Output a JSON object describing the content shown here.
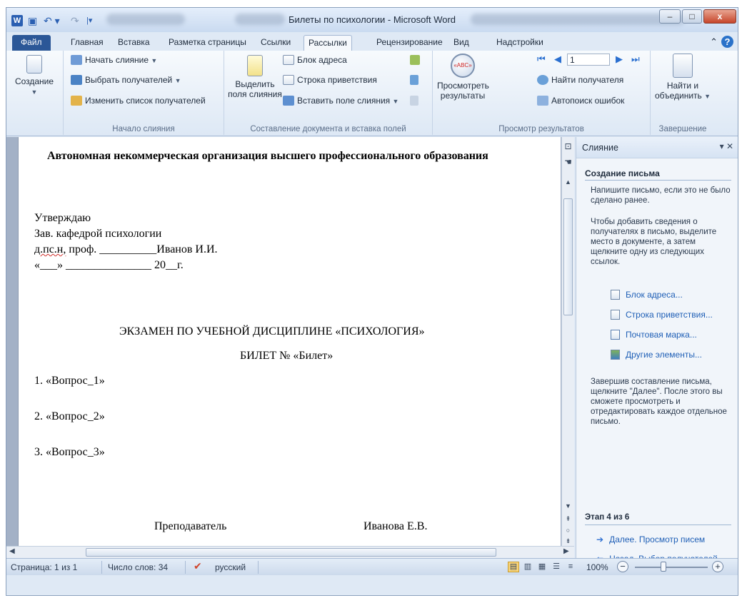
{
  "window": {
    "title": "Билеты по психологии - Microsoft Word",
    "app_letter": "W",
    "minimize": "–",
    "maximize": "□",
    "close": "x"
  },
  "tabs": [
    {
      "label": "Файл"
    },
    {
      "label": "Главная"
    },
    {
      "label": "Вставка"
    },
    {
      "label": "Разметка страницы"
    },
    {
      "label": "Ссылки"
    },
    {
      "label": "Рассылки"
    },
    {
      "label": "Рецензирование"
    },
    {
      "label": "Вид"
    },
    {
      "label": "Надстройки"
    }
  ],
  "active_tab": "Рассылки",
  "ribbon": {
    "create_label": "Создание",
    "start_merge": {
      "label": "Начало слияния",
      "start": "Начать слияние",
      "select_recipients": "Выбрать получателей",
      "edit_list": "Изменить список получателей"
    },
    "compose": {
      "label": "Составление документа и вставка полей",
      "highlight_line1": "Выделить",
      "highlight_line2": "поля слияния",
      "address_block": "Блок адреса",
      "greeting_line": "Строка приветствия",
      "insert_field": "Вставить поле слияния"
    },
    "preview": {
      "label": "Просмотр результатов",
      "preview_line1": "Просмотреть",
      "preview_line2": "результаты",
      "record_number": "1",
      "find_recipient": "Найти получателя",
      "auto_check": "Автопоиск ошибок",
      "abc": "«ABC»"
    },
    "finish": {
      "label": "Завершение",
      "line1": "Найти и",
      "line2": "объединить"
    }
  },
  "document": {
    "org": "Автономная некоммерческая организация высшего профессионального образования",
    "approve": "Утверждаю",
    "head": "Зав. кафедрой психологии",
    "degree": "д.пс.н,",
    "degree_rest": " проф. __________Иванов И.И.",
    "date_line": "«___» _______________ 20__г.",
    "exam": "ЭКЗАМЕН ПО УЧЕБНОЙ ДИСЦИПЛИНЕ «ПСИХОЛОГИЯ»",
    "ticket": "БИЛЕТ №  «Билет»",
    "q1": "1. «Вопрос_1»",
    "q2": "2. «Вопрос_2»",
    "q3": "3.  «Вопрос_3»",
    "teacher_label": "Преподаватель",
    "teacher_name": "Иванова Е.В."
  },
  "pane": {
    "title": "Слияние",
    "heading": "Создание письма",
    "intro": "Напишите письмо, если это не было сделано ранее.",
    "instructions": "Чтобы добавить сведения о получателях в письмо, выделите место в документе, а затем щелкните одну из следующих ссылок.",
    "links": [
      {
        "label": "Блок адреса..."
      },
      {
        "label": "Строка приветствия..."
      },
      {
        "label": "Почтовая марка..."
      },
      {
        "label": "Другие элементы..."
      }
    ],
    "finish_text": "Завершив составление письма, щелкните \"Далее\". После этого вы сможете просмотреть и отредактировать каждое отдельное письмо.",
    "step": "Этап 4 из 6",
    "next": "Далее. Просмотр писем",
    "back": "Назад. Выбор получателей"
  },
  "status": {
    "page": "Страница: 1 из 1",
    "words": "Число слов: 34",
    "language": "русский",
    "zoom": "100%"
  },
  "colors": {
    "file_tab": "#2b5797",
    "link": "#1f5fb6",
    "ribbon_bg": "#dde8f5"
  }
}
